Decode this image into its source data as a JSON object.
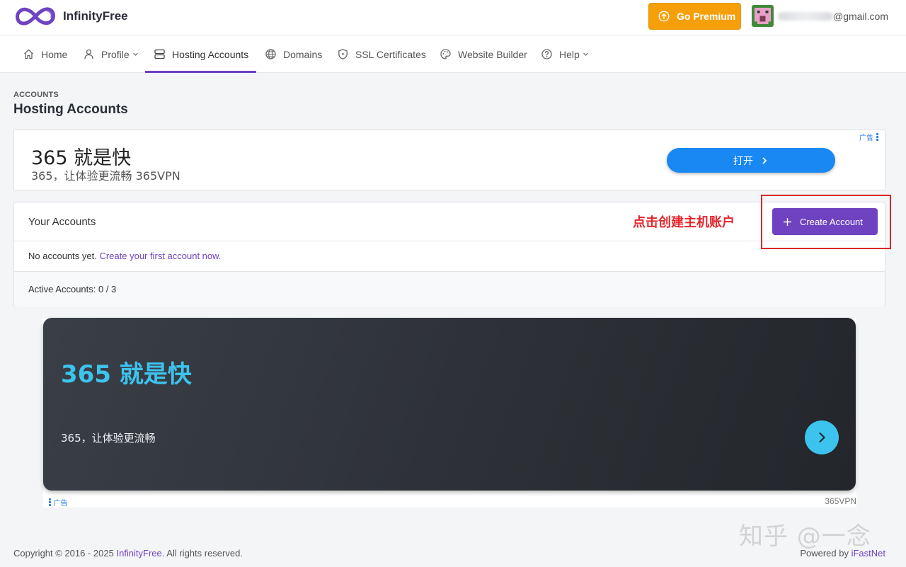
{
  "header": {
    "brand": "InfinityFree",
    "premium_label": "Go Premium",
    "email_suffix": "@gmail.com"
  },
  "nav": {
    "items": [
      {
        "label": "Home",
        "icon": "home-icon"
      },
      {
        "label": "Profile",
        "icon": "user-icon",
        "dropdown": true
      },
      {
        "label": "Hosting Accounts",
        "icon": "server-icon",
        "active": true
      },
      {
        "label": "Domains",
        "icon": "globe-icon"
      },
      {
        "label": "SSL Certificates",
        "icon": "shield-icon"
      },
      {
        "label": "Website Builder",
        "icon": "palette-icon"
      },
      {
        "label": "Help",
        "icon": "help-icon",
        "dropdown": true
      }
    ]
  },
  "page": {
    "breadcrumb": "ACCOUNTS",
    "title": "Hosting Accounts"
  },
  "ad_top": {
    "title": "365 就是快",
    "subtitle": "365，让体验更流畅 365VPN",
    "button": "打开",
    "mark": "广告"
  },
  "accounts": {
    "title": "Your Accounts",
    "annotation": "点击创建主机账户",
    "create_label": "Create Account",
    "empty_text": "No accounts yet.",
    "empty_link": "Create your first account now.",
    "active_text": "Active Accounts: 0 / 3"
  },
  "ad_bottom": {
    "title": "365 就是快",
    "subtitle": "365，让体验更流畅",
    "mark": "广告",
    "brand": "365VPN"
  },
  "footer": {
    "copyright_prefix": "Copyright © 2016 - 2025",
    "copyright_link": "InfinityFree",
    "copyright_suffix": ". All rights reserved.",
    "powered_prefix": "Powered by",
    "powered_link": "iFastNet",
    "watermark": "知乎 @一念"
  },
  "colors": {
    "accent": "#6f42c1",
    "premium": "#f59f0a",
    "ad_button": "#1a88f2",
    "ad_highlight": "#3cc4ee",
    "annotation": "#e3262b"
  }
}
